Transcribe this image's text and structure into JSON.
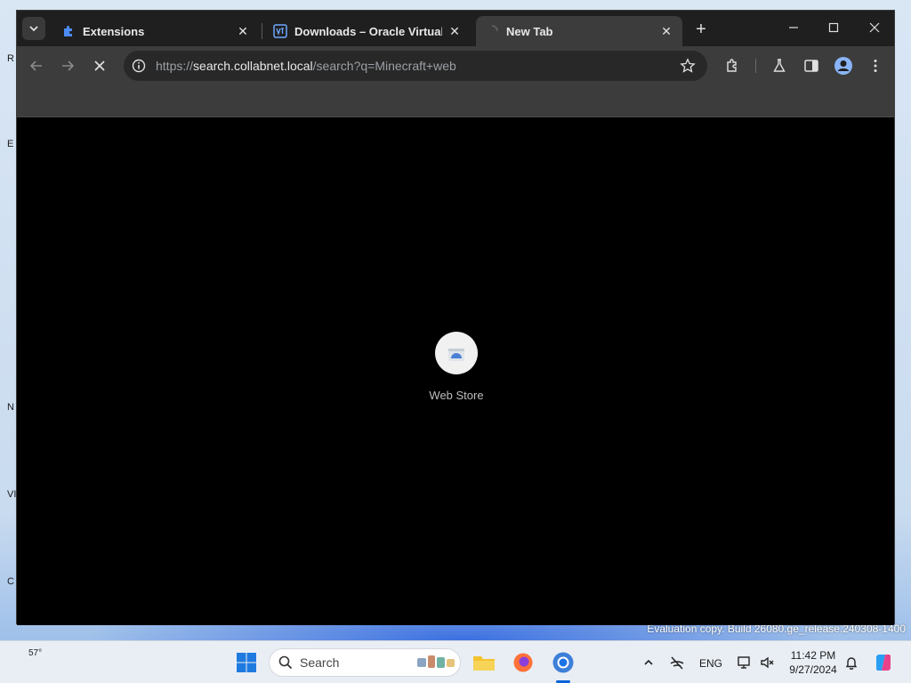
{
  "desktop": {
    "watermark": "Evaluation copy. Build 26080.ge_release.240308-1400"
  },
  "browser": {
    "tabs": [
      {
        "title": "Extensions",
        "icon": "puzzle-icon",
        "active": false
      },
      {
        "title": "Downloads – Oracle VirtualBox",
        "icon": "virtualbox-icon",
        "active": false
      },
      {
        "title": "New Tab",
        "icon": "loading-icon",
        "active": true
      }
    ],
    "url": {
      "scheme": "https://",
      "host": "search.collabnet.local",
      "path": "/search?q=Minecraft+web"
    },
    "shortcuts": [
      {
        "label": "Web Store",
        "icon": "webstore-icon"
      }
    ]
  },
  "taskbar": {
    "weather": {
      "temp": "57°",
      "icon": "weather-sun-icon"
    },
    "search_placeholder": "Search",
    "language": "ENG",
    "clock": {
      "time": "11:42 PM",
      "date": "9/27/2024"
    }
  },
  "colors": {
    "accent": "#0a64d8",
    "browser_bg": "#000000",
    "toolbar": "#3c3c3c",
    "tabstrip": "#1f1f1f"
  }
}
